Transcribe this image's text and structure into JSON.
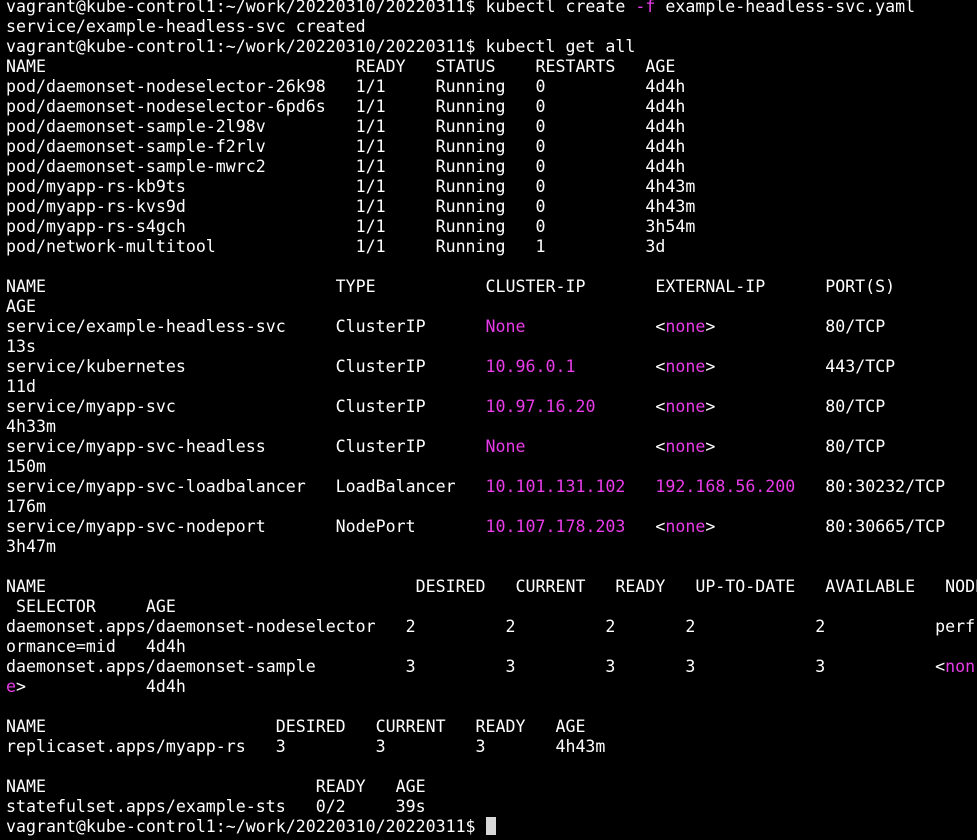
{
  "terminal": {
    "lines": [
      [
        {
          "t": "vagrant@kube-control1:~/work/20220310/20220311$ kubectl create "
        },
        {
          "t": "-f",
          "c": "flag"
        },
        {
          "t": " example-headless-svc.yaml"
        }
      ],
      [
        {
          "t": "service/example-headless-svc created"
        }
      ],
      [
        {
          "t": "vagrant@kube-control1:~/work/20220310/20220311$ kubectl get all"
        }
      ],
      [
        {
          "t": "NAME                               READY   STATUS    RESTARTS   AGE"
        }
      ],
      [
        {
          "t": "pod/daemonset-nodeselector-26k98   1/1     Running   0          4d4h"
        }
      ],
      [
        {
          "t": "pod/daemonset-nodeselector-6pd6s   1/1     Running   0          4d4h"
        }
      ],
      [
        {
          "t": "pod/daemonset-sample-2l98v         1/1     Running   0          4d4h"
        }
      ],
      [
        {
          "t": "pod/daemonset-sample-f2rlv         1/1     Running   0          4d4h"
        }
      ],
      [
        {
          "t": "pod/daemonset-sample-mwrc2         1/1     Running   0          4d4h"
        }
      ],
      [
        {
          "t": "pod/myapp-rs-kb9ts                 1/1     Running   0          4h43m"
        }
      ],
      [
        {
          "t": "pod/myapp-rs-kvs9d                 1/1     Running   0          4h43m"
        }
      ],
      [
        {
          "t": "pod/myapp-rs-s4gch                 1/1     Running   0          3h54m"
        }
      ],
      [
        {
          "t": "pod/network-multitool              1/1     Running   1          3d"
        }
      ],
      [
        {
          "t": ""
        }
      ],
      [
        {
          "t": "NAME                             TYPE           CLUSTER-IP       EXTERNAL-IP      PORT(S)"
        }
      ],
      [
        {
          "t": "AGE"
        }
      ],
      [
        {
          "t": "service/example-headless-svc     ClusterIP      "
        },
        {
          "t": "None",
          "c": "magenta"
        },
        {
          "t": "             <"
        },
        {
          "t": "none",
          "c": "magenta"
        },
        {
          "t": ">           80/TCP"
        }
      ],
      [
        {
          "t": "13s"
        }
      ],
      [
        {
          "t": "service/kubernetes               ClusterIP      "
        },
        {
          "t": "10.96.0.1",
          "c": "magenta"
        },
        {
          "t": "        <"
        },
        {
          "t": "none",
          "c": "magenta"
        },
        {
          "t": ">           443/TCP"
        }
      ],
      [
        {
          "t": "11d"
        }
      ],
      [
        {
          "t": "service/myapp-svc                ClusterIP      "
        },
        {
          "t": "10.97.16.20",
          "c": "magenta"
        },
        {
          "t": "      <"
        },
        {
          "t": "none",
          "c": "magenta"
        },
        {
          "t": ">           80/TCP"
        }
      ],
      [
        {
          "t": "4h33m"
        }
      ],
      [
        {
          "t": "service/myapp-svc-headless       ClusterIP      "
        },
        {
          "t": "None",
          "c": "magenta"
        },
        {
          "t": "             <"
        },
        {
          "t": "none",
          "c": "magenta"
        },
        {
          "t": ">           80/TCP"
        }
      ],
      [
        {
          "t": "150m"
        }
      ],
      [
        {
          "t": "service/myapp-svc-loadbalancer   LoadBalancer   "
        },
        {
          "t": "10.101.131.102",
          "c": "magenta"
        },
        {
          "t": "   "
        },
        {
          "t": "192.168.56.200",
          "c": "magenta"
        },
        {
          "t": "   80:30232/TCP"
        }
      ],
      [
        {
          "t": "176m"
        }
      ],
      [
        {
          "t": "service/myapp-svc-nodeport       NodePort       "
        },
        {
          "t": "10.107.178.203",
          "c": "magenta"
        },
        {
          "t": "   <"
        },
        {
          "t": "none",
          "c": "magenta"
        },
        {
          "t": ">           80:30665/TCP"
        }
      ],
      [
        {
          "t": "3h47m"
        }
      ],
      [
        {
          "t": ""
        }
      ],
      [
        {
          "t": "NAME                                     DESIRED   CURRENT   READY   UP-TO-DATE   AVAILABLE   NODE"
        }
      ],
      [
        {
          "t": " SELECTOR     AGE"
        }
      ],
      [
        {
          "t": "daemonset.apps/daemonset-nodeselector   2         2         2       2            2           perf"
        }
      ],
      [
        {
          "t": "ormance=mid   4d4h"
        }
      ],
      [
        {
          "t": "daemonset.apps/daemonset-sample         3         3         3       3            3           <"
        },
        {
          "t": "non",
          "c": "magenta"
        }
      ],
      [
        {
          "t": "e",
          "c": "magenta"
        },
        {
          "t": ">            4d4h"
        }
      ],
      [
        {
          "t": ""
        }
      ],
      [
        {
          "t": "NAME                       DESIRED   CURRENT   READY   AGE"
        }
      ],
      [
        {
          "t": "replicaset.apps/myapp-rs   3         3         3       4h43m"
        }
      ],
      [
        {
          "t": ""
        }
      ],
      [
        {
          "t": "NAME                           READY   AGE"
        }
      ],
      [
        {
          "t": "statefulset.apps/example-sts   0/2     39s"
        }
      ],
      [
        {
          "t": "vagrant@kube-control1:~/work/20220310/20220311$ "
        },
        {
          "t": "",
          "c": "cursor"
        }
      ]
    ]
  },
  "colors": {
    "background": "#000000",
    "foreground": "#ffffff",
    "highlight": "#e83ce8"
  }
}
